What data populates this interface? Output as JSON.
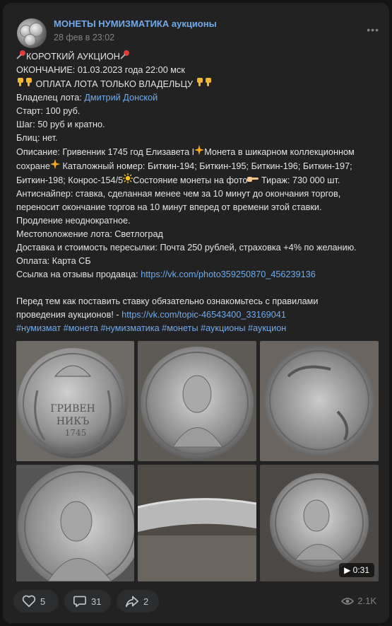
{
  "post": {
    "group_name": "МОНЕТЫ НУМИЗМАТИКА аукционы",
    "date": "28 фев в 23:02",
    "more": "•••",
    "lines": {
      "title": "КОРОТКИЙ АУКЦИОН",
      "end": "ОКОНЧАНИЕ: 01.03.2023 года 22:00 мск",
      "pay_owner": "ОПЛАТА ЛОТА ТОЛЬКО ВЛАДЕЛЬЦУ",
      "owner_label": "Владелец лота: ",
      "owner_name": "Дмитрий Донской",
      "start": "Старт: 100 руб.",
      "step": "Шаг: 50 руб и кратно.",
      "blitz": "Блиц: нет.",
      "desc_1": "Описание: Гривенник 1745 год Елизавета I",
      "desc_2": "Монета в шикарном коллекционном",
      "desc_3": "сохране",
      "desc_4": " Каталожный номер: Биткин-194; Биткин-195; Биткин-196; Биткин-197;",
      "desc_5": "Биткин-198; Конрос-154/5",
      "desc_6": "Состояние монеты на фото",
      "desc_7": " Тираж: 730 000 шт.",
      "antisniper_1": "Антиснайпер: ставка, сделанная менее чем за 10 минут до окончания торгов,",
      "antisniper_2": "переносит окончание торгов на 10 минут вперед от времени этой ставки.",
      "extension": "Продление неоднократное.",
      "location": "Местоположение лота: Светлоград",
      "delivery": "Доставка и стоимость пересылки: Почта 250 рублей, страховка +4% по желанию.",
      "payment": "Оплата: Карта СБ",
      "reviews_label": "Ссылка на отзывы продавца: ",
      "reviews_link": "https://vk.com/photo359250870_456239136",
      "rules_1": "Перед тем как поставить ставку обязательно ознакомьтесь с правилами",
      "rules_2": "проведения аукционов! - ",
      "rules_link": "https://vk.com/topic-46543400_33169041",
      "hashtags": "#нумизмат #монета #нумизматика #монеты #аукционы #аукцион"
    },
    "video_duration": "0:31",
    "likes": "5",
    "comments": "31",
    "shares": "2",
    "views": "2.1K"
  },
  "icons": [
    "pin-icon",
    "thumbs-down-icon",
    "sparkle-icon",
    "sun-icon",
    "pointing-hand-icon",
    "heart-icon",
    "comment-icon",
    "share-icon",
    "eye-icon",
    "more-icon",
    "play-icon"
  ],
  "colors": {
    "accent": "#71aaeb",
    "background": "#222222",
    "text": "#e1e3e6",
    "muted": "#828282"
  }
}
